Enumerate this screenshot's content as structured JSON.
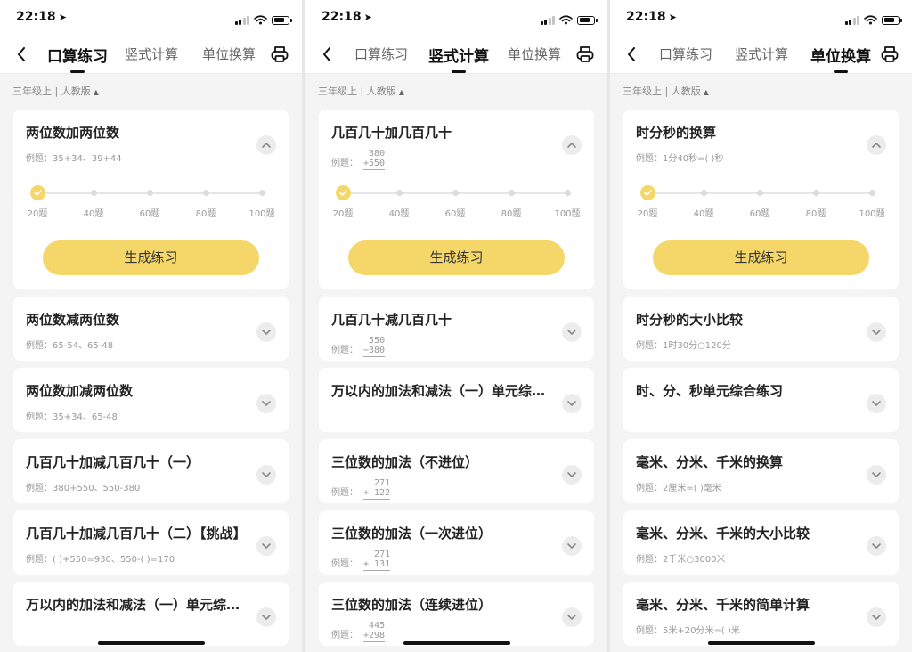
{
  "time": "22:18",
  "grade_label": "三年级上 | 人教版",
  "tabs": [
    "口算练习",
    "竖式计算",
    "单位换算"
  ],
  "generate_label": "生成练习",
  "slider_ticks": [
    "20题",
    "40题",
    "60题",
    "80题",
    "100题"
  ],
  "slider_value": "20题",
  "colors": {
    "accent": "#f5d769",
    "background": "#f4f4f4",
    "card": "#ffffff"
  },
  "screens": [
    {
      "active_tab": 0,
      "items": [
        {
          "title": "两位数加两位数",
          "example_prefix": "例题：",
          "example": "35+34、39+44",
          "expanded": true
        },
        {
          "title": "两位数减两位数",
          "example_prefix": "例题：",
          "example": "65-54、65-48"
        },
        {
          "title": "两位数加减两位数",
          "example_prefix": "例题：",
          "example": "35+34、65-48"
        },
        {
          "title": "几百几十加减几百几十（一）",
          "example_prefix": "例题：",
          "example": "380+550、550-380"
        },
        {
          "title": "几百几十加减几百几十（二）【挑战】",
          "example_prefix": "例题：",
          "example": "(   )+550=930、550-(   )=170"
        },
        {
          "title": "万以内的加法和减法（一）单元综合练习",
          "example_prefix": "",
          "example": ""
        }
      ]
    },
    {
      "active_tab": 1,
      "items": [
        {
          "title": "几百几十加几百几十",
          "example_prefix": "例题：",
          "vertical": {
            "top": "380",
            "bottom": "+550"
          },
          "expanded": true
        },
        {
          "title": "几百几十减几百几十",
          "example_prefix": "例题：",
          "vertical": {
            "top": "550",
            "bottom": "−380"
          }
        },
        {
          "title": "万以内的加法和减法（一）单元综合练习",
          "example_prefix": ""
        },
        {
          "title": "三位数的加法（不进位）",
          "example_prefix": "例题：",
          "vertical": {
            "top": "271",
            "bottom": "+ 122"
          }
        },
        {
          "title": "三位数的加法（一次进位）",
          "example_prefix": "例题：",
          "vertical": {
            "top": "271",
            "bottom": "+ 131"
          }
        },
        {
          "title": "三位数的加法（连续进位）",
          "example_prefix": "例题：",
          "vertical": {
            "top": "445",
            "bottom": "+298"
          }
        }
      ]
    },
    {
      "active_tab": 2,
      "items": [
        {
          "title": "时分秒的换算",
          "example_prefix": "例题：",
          "example": "1分40秒=(   )秒",
          "expanded": true
        },
        {
          "title": "时分秒的大小比较",
          "example_prefix": "例题：",
          "example": "1时30分○120分"
        },
        {
          "title": "时、分、秒单元综合练习",
          "example_prefix": "",
          "example": ""
        },
        {
          "title": "毫米、分米、千米的换算",
          "example_prefix": "例题：",
          "example": "2厘米=(   )毫米"
        },
        {
          "title": "毫米、分米、千米的大小比较",
          "example_prefix": "例题：",
          "example": "2千米○3000米"
        },
        {
          "title": "毫米、分米、千米的简单计算",
          "example_prefix": "例题：",
          "example": "5米+20分米=(   )米"
        }
      ]
    }
  ]
}
